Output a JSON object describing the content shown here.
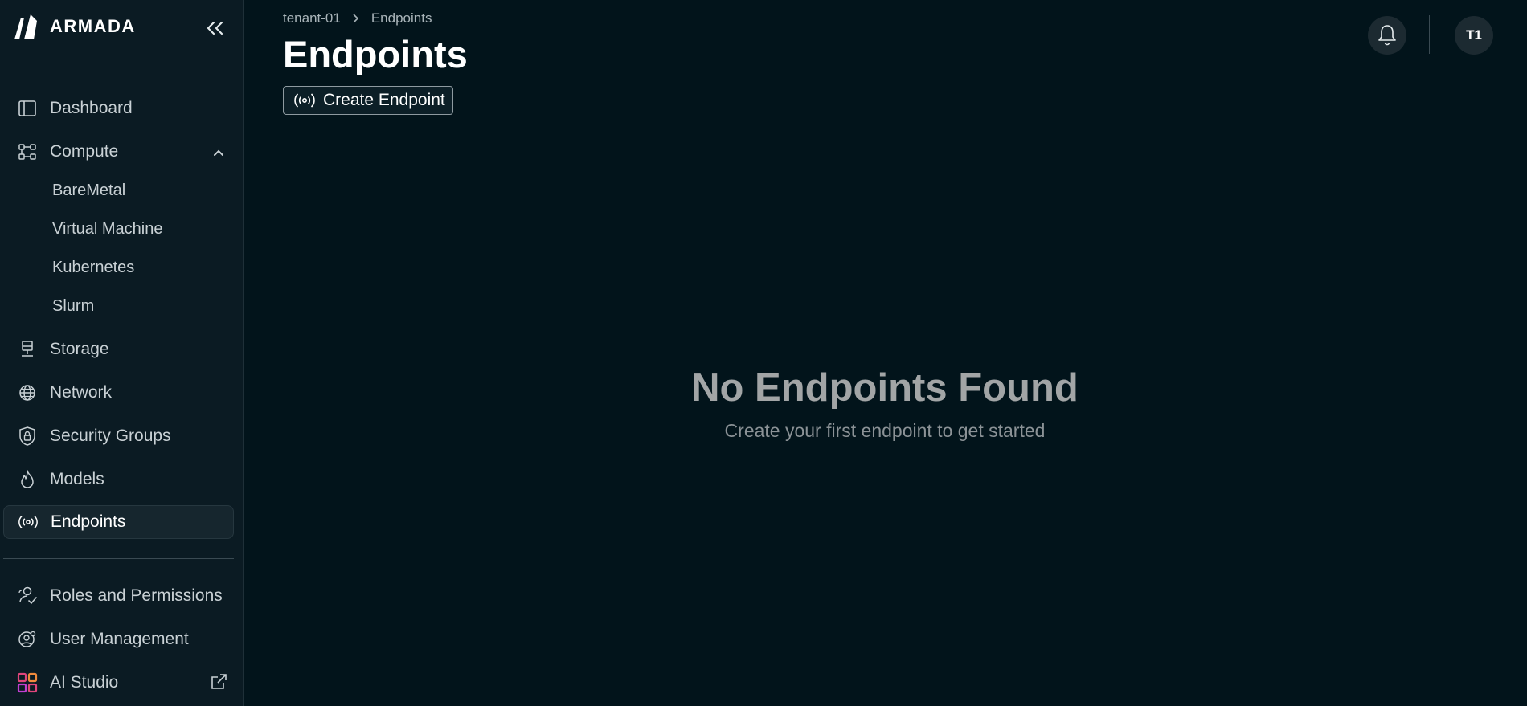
{
  "brand": {
    "name": "ARMADA"
  },
  "sidebar": {
    "nav": [
      {
        "label": "Dashboard",
        "icon": "dashboard-icon"
      },
      {
        "label": "Compute",
        "icon": "compute-icon",
        "expanded": true
      },
      {
        "label": "Storage",
        "icon": "storage-icon"
      },
      {
        "label": "Network",
        "icon": "globe-icon"
      },
      {
        "label": "Security Groups",
        "icon": "shield-lock-icon"
      },
      {
        "label": "Models",
        "icon": "flame-icon"
      },
      {
        "label": "Endpoints",
        "icon": "broadcast-icon",
        "active": true
      }
    ],
    "compute_children": [
      "BareMetal",
      "Virtual Machine",
      "Kubernetes",
      "Slurm"
    ],
    "bottom": [
      {
        "label": "Roles and Permissions",
        "icon": "roles-icon"
      },
      {
        "label": "User Management",
        "icon": "user-gear-icon"
      },
      {
        "label": "AI Studio",
        "icon": "ai-studio-icon",
        "external": true
      }
    ]
  },
  "breadcrumb": {
    "tenant": "tenant-01",
    "current": "Endpoints"
  },
  "page": {
    "title": "Endpoints",
    "create_label": "Create Endpoint"
  },
  "header": {
    "avatar_initials": "T1"
  },
  "empty_state": {
    "title": "No Endpoints Found",
    "subtitle": "Create your first endpoint to get started"
  },
  "colors": {
    "background": "#02141b",
    "sidebar": "#0b1b23",
    "active_item": "#16262e",
    "ai_studio_tiles": [
      "#e0457b",
      "#f08a3c",
      "#c13fd0",
      "#e0457b"
    ]
  }
}
